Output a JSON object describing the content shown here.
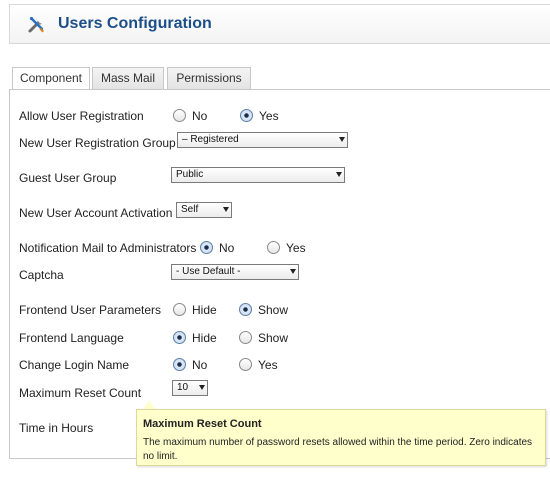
{
  "header": {
    "title": "Users Configuration",
    "icon": "tools-icon"
  },
  "tabs": [
    {
      "label": "Component",
      "active": true
    },
    {
      "label": "Mass Mail",
      "active": false
    },
    {
      "label": "Permissions",
      "active": false
    }
  ],
  "fields": {
    "allow_registration": {
      "label": "Allow User Registration",
      "options": [
        "No",
        "Yes"
      ],
      "selected": "Yes"
    },
    "new_user_group": {
      "label": "New User Registration Group",
      "value": "– Registered"
    },
    "guest_group": {
      "label": "Guest User Group",
      "value": "Public"
    },
    "activation": {
      "label": "New User Account Activation",
      "value": "Self"
    },
    "notification": {
      "label": "Notification Mail to Administrators",
      "options": [
        "No",
        "Yes"
      ],
      "selected": "No"
    },
    "captcha": {
      "label": "Captcha",
      "value": "- Use Default -"
    },
    "frontend_params": {
      "label": "Frontend User Parameters",
      "options": [
        "Hide",
        "Show"
      ],
      "selected": "Show"
    },
    "frontend_language": {
      "label": "Frontend Language",
      "options": [
        "Hide",
        "Show"
      ],
      "selected": "Hide"
    },
    "change_login": {
      "label": "Change Login Name",
      "options": [
        "No",
        "Yes"
      ],
      "selected": "No"
    },
    "max_reset": {
      "label": "Maximum Reset Count",
      "value": "10"
    },
    "time_hours": {
      "label": "Time in Hours"
    }
  },
  "tooltip": {
    "title": "Maximum Reset Count",
    "text": "The maximum number of password resets allowed within the time period. Zero indicates no limit."
  },
  "colors": {
    "title": "#1c4f8a",
    "tooltip_bg": "#ffffcc"
  }
}
